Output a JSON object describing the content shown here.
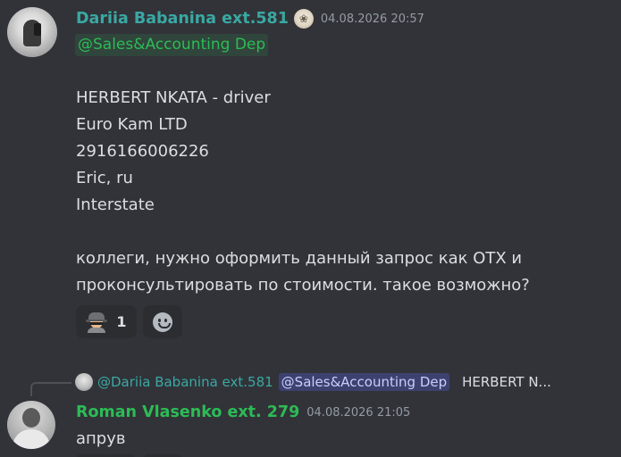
{
  "messages": [
    {
      "author": "Dariia Babanina ext.581",
      "author_color": "#3aa8a3",
      "timestamp": "04.08.2026 20:57",
      "mention": "@Sales&Accounting Dep",
      "lines": [
        "HERBERT NKATA  - driver",
        "Euro Kam LTD",
        "2916166006226",
        "Eric, ru",
        "Interstate",
        "коллеги, нужно оформить данный запрос как OTX и",
        "проконсультировать по стоимости. такое возможно?"
      ],
      "reactions": [
        {
          "icon": "spy-emoji",
          "count": "1"
        },
        {
          "icon": "add-reaction-icon"
        }
      ]
    },
    {
      "reply_to": {
        "author": "@Dariia Babanina ext.581",
        "mention": "@Sales&Accounting Dep",
        "preview": "HERBERT N..."
      },
      "author": "Roman Vlasenko ext. 279",
      "author_color": "#2dbb55",
      "timestamp": "04.08.2026 21:05",
      "text": "апрув"
    }
  ],
  "colors": {
    "background": "#313338",
    "mention_green": "#2dbb55",
    "mention_blue": "#5865f2"
  }
}
